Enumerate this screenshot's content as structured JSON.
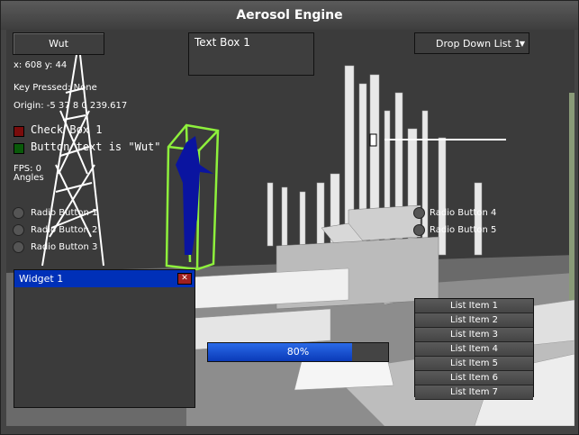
{
  "window": {
    "title": "Aerosol Engine"
  },
  "controls": {
    "button_label": "Wut",
    "textbox_value": "Text Box 1",
    "dropdown_value": "Drop Down List 1",
    "coords": "x: 608 y: 44",
    "key_pressed": "Key Pressed: None",
    "origin": "Origin: -5 37 8 0 239.617",
    "checkbox1_label": "Check Box 1",
    "checkbox2_label": "Button text is \"Wut\"",
    "checkbox1_color": "#7a0c0c",
    "checkbox2_color": "#0a5a0a",
    "fps": "FPS: 0",
    "angles": "Angles",
    "radio_left": [
      "Radio Button 1",
      "Radio Button 2",
      "Radio Button 3"
    ],
    "radio_right": [
      "Radio Button 4",
      "Radio Button 5"
    ]
  },
  "widget": {
    "title": "Widget 1",
    "title_color": "#0030b8"
  },
  "progress": {
    "value": 0.8,
    "label": "80%"
  },
  "listbox": {
    "items": [
      "List Item 1",
      "List Item 2",
      "List Item 3",
      "List Item 4",
      "List Item 5",
      "List Item 6",
      "List Item 7"
    ]
  }
}
